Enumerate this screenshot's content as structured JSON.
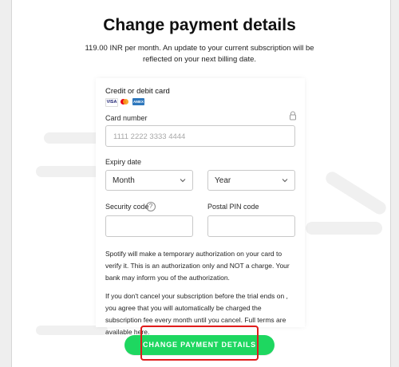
{
  "page": {
    "title": "Change payment details",
    "subtitle": "119.00 INR per month. An update to your current subscription will be reflected on your next billing date."
  },
  "form": {
    "card_heading": "Credit or debit card",
    "card_brands": [
      "VISA",
      "Mastercard",
      "AMEX"
    ],
    "card_number_label": "Card number",
    "card_number_placeholder": "1111 2222 3333 4444",
    "expiry_label": "Expiry date",
    "month_selected": "Month",
    "year_selected": "Year",
    "security_code_label": "Security code",
    "help_glyph": "?",
    "postal_label": "Postal PIN code",
    "disclaimer": "Spotify will make a temporary authorization on your card to verify it. This is an authorization only and NOT a charge. Your bank may inform you of the authorization.",
    "terms_prefix": "If you don't cancel your subscription before the trial ends on , you agree that you will automatically be charged the subscription fee every month until you cancel. Full terms are available ",
    "terms_link": "here",
    "terms_suffix": ".",
    "submit_label": "CHANGE PAYMENT DETAILS"
  },
  "colors": {
    "accent": "#1ed760",
    "highlight": "#e01b1b"
  },
  "icons": [
    "visa-logo",
    "mastercard-logo",
    "amex-logo",
    "lock-icon",
    "chevron-down-icon",
    "help-icon"
  ]
}
